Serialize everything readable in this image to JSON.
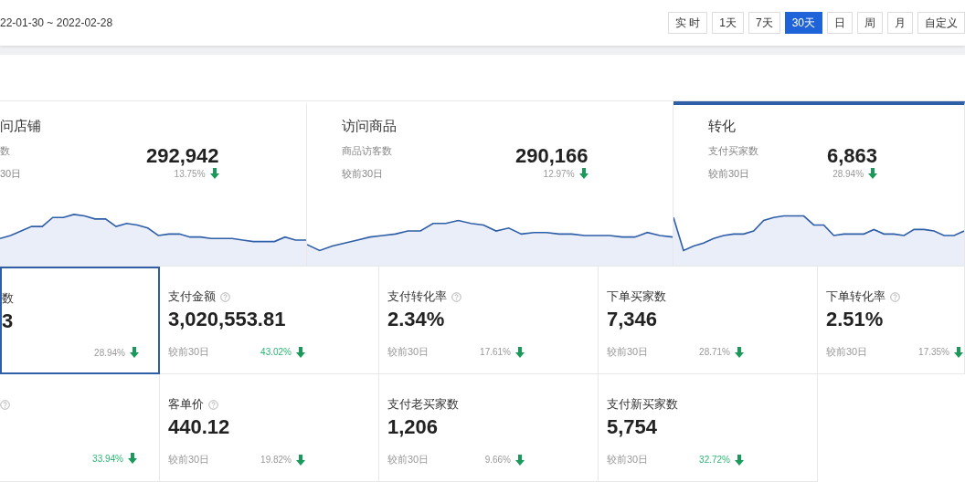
{
  "date_range": "22-01-30 ~ 2022-02-28",
  "periods": [
    {
      "label": "实 时",
      "selected": false
    },
    {
      "label": "1天",
      "selected": false
    },
    {
      "label": "7天",
      "selected": false
    },
    {
      "label": "30天",
      "selected": true
    },
    {
      "label": "日",
      "selected": false
    },
    {
      "label": "周",
      "selected": false
    },
    {
      "label": "月",
      "selected": false
    },
    {
      "label": "自定义",
      "selected": false
    }
  ],
  "overview": [
    {
      "title": "问店铺",
      "metric": "数",
      "compare": "30日",
      "value": "292,942",
      "change": "13.75%",
      "selected": false
    },
    {
      "title": "访问商品",
      "metric": "商品访客数",
      "compare": "较前30日",
      "value": "290,166",
      "change": "12.97%",
      "selected": false
    },
    {
      "title": "转化",
      "metric": "支付买家数",
      "compare": "较前30日",
      "value": "6,863",
      "change": "28.94%",
      "selected": true
    }
  ],
  "metrics": [
    {
      "label": "数",
      "help": false,
      "value": "3",
      "change": "28.94%",
      "color": "#999999",
      "selected": true
    },
    {
      "label": "支付金额",
      "help": true,
      "value": "3,020,553.81",
      "compare": "较前30日",
      "change": "43.02%",
      "color": "#2bb673",
      "selected": false
    },
    {
      "label": "支付转化率",
      "help": true,
      "value": "2.34%",
      "compare": "较前30日",
      "change": "17.61%",
      "color": "#999999",
      "selected": false
    },
    {
      "label": "下单买家数",
      "help": false,
      "value": "7,346",
      "compare": "较前30日",
      "change": "28.71%",
      "color": "#999999",
      "selected": false
    },
    {
      "label": "下单转化率",
      "help": true,
      "value": "2.51%",
      "compare": "较前30日",
      "change": "17.35%",
      "color": "#999999",
      "selected": false
    },
    {
      "help": true,
      "change": "33.94%",
      "color": "#2bb673",
      "selected": false
    },
    {
      "label": "客单价",
      "help": true,
      "value": "440.12",
      "compare": "较前30日",
      "change": "19.82%",
      "color": "#999999",
      "selected": false
    },
    {
      "label": "支付老买家数",
      "help": false,
      "value": "1,206",
      "compare": "较前30日",
      "change": "9.66%",
      "color": "#999999",
      "selected": false
    },
    {
      "label": "支付新买家数",
      "help": false,
      "value": "5,754",
      "compare": "较前30日",
      "change": "32.72%",
      "color": "#2bb673",
      "selected": false
    }
  ]
}
